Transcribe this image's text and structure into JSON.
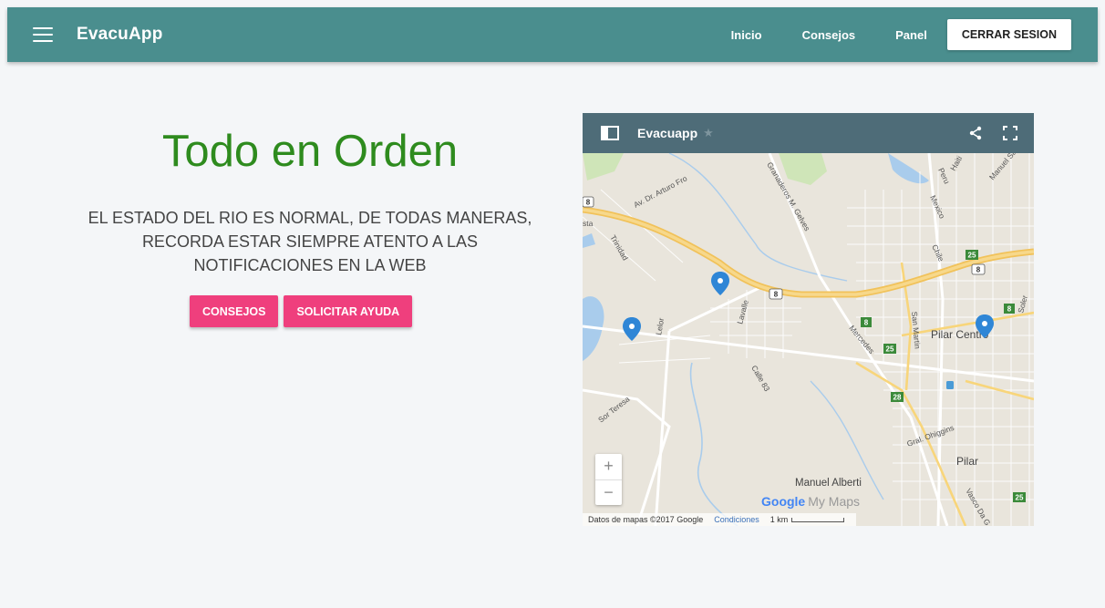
{
  "header": {
    "brand": "EvacuApp",
    "nav": [
      "Inicio",
      "Consejos",
      "Panel"
    ],
    "logout_label": "CERRAR SESION",
    "color": "#4a8e8e"
  },
  "status": {
    "headline": "Todo en Orden",
    "message_lines": [
      "EL ESTADO DEL RIO ES NORMAL, DE TODAS MANERAS,",
      "RECORDA ESTAR SIEMPRE ATENTO A LAS",
      "NOTIFICACIONES EN LA WEB"
    ],
    "headline_color": "#2e8b1e"
  },
  "actions": {
    "tips_label": "CONSEJOS",
    "help_label": "SOLICITAR AYUDA",
    "color": "#ef3f7d"
  },
  "map": {
    "title": "Evacuapp",
    "labels": {
      "arturo": "Av. Dr. Arturo Fro",
      "granaderos": "Granaderos M. Gelves",
      "peru": "Peru",
      "mexico": "Mexico",
      "haiti": "Haiti",
      "manuel_savio": "Manuel Savio",
      "trinidad": "Trinidad",
      "chile": "Chile",
      "lelor": "Lelor",
      "lavalle": "Lavalle",
      "mercedes": "Mercedes",
      "san_martin": "San Martin",
      "calle83": "Calle 83",
      "sor_teresa": "Sor Teresa",
      "pilar_centro": "Pilar Centro",
      "pilar": "Pilar",
      "ohiggins": "Gral. Ohiggins",
      "manuel_alberti": "Manuel Alberti",
      "vasco": "Vasco Da G",
      "sta": "sta",
      "soler": "Soler"
    },
    "route_shields": [
      "8",
      "8",
      "8",
      "25",
      "8",
      "8",
      "25",
      "28",
      "25"
    ],
    "zoom_in": "+",
    "zoom_out": "−",
    "google": "Google",
    "my_maps": "My Maps",
    "attribution": "Datos de mapas ©2017 Google",
    "terms": "Condiciones",
    "scale": "1 km"
  }
}
